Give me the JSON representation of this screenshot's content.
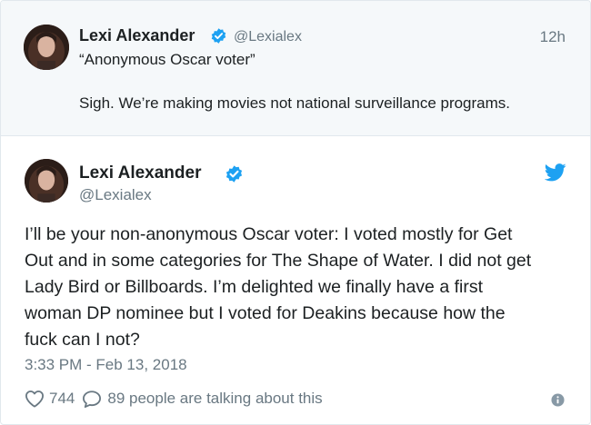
{
  "parent_tweet": {
    "author_name": "Lexi Alexander",
    "handle": "@Lexialex",
    "timestamp": "12h",
    "lines": [
      "“Anonymous Oscar voter”",
      "Sigh. We’re making movies not national surveillance programs."
    ]
  },
  "main_tweet": {
    "author_name": "Lexi Alexander",
    "handle": "@Lexialex",
    "text_lines": [
      "I’ll be your non-anonymous Oscar voter: I voted mostly for Get",
      "Out and in some categories for The Shape of Water. I did not get",
      "Lady Bird or Billboards. I’m delighted we finally have a first",
      "woman DP nominee but I voted for Deakins because how the",
      "fuck can I not?"
    ],
    "date": "3:33 PM - Feb 13, 2018",
    "like_count": "744",
    "talking_text": "89 people are talking about this"
  },
  "icons": {
    "verified": "verified-badge-icon",
    "brand": "twitter-bird-icon",
    "like": "heart-icon",
    "reply": "reply-bubble-icon",
    "info": "info-icon"
  },
  "colors": {
    "brand_blue": "#1da1f2",
    "text": "#1c2022",
    "muted": "#697882",
    "parent_bg": "#f5f8fa",
    "border": "#e1e8ed"
  }
}
